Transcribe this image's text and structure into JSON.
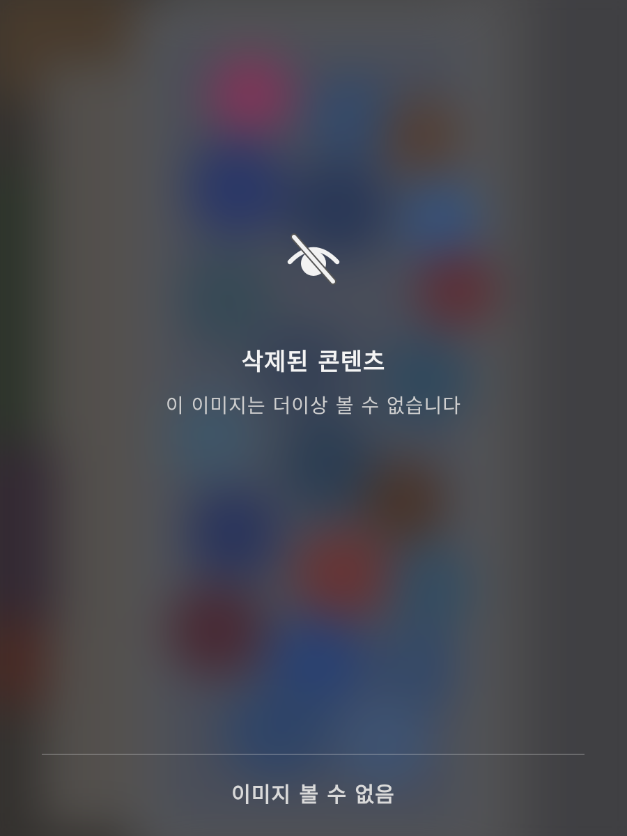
{
  "overlay": {
    "icon": "eye-slash-icon",
    "title": "삭제된 콘텐츠",
    "subtitle": "이 이미지는 더이상 볼 수 없습니다"
  },
  "footer": {
    "button_label": "이미지 볼 수 없음"
  },
  "colors": {
    "title": "#f4f4f4",
    "subtitle": "#cfcfcf",
    "divider": "#dcdcdc",
    "button_text": "#d9d9d9"
  }
}
